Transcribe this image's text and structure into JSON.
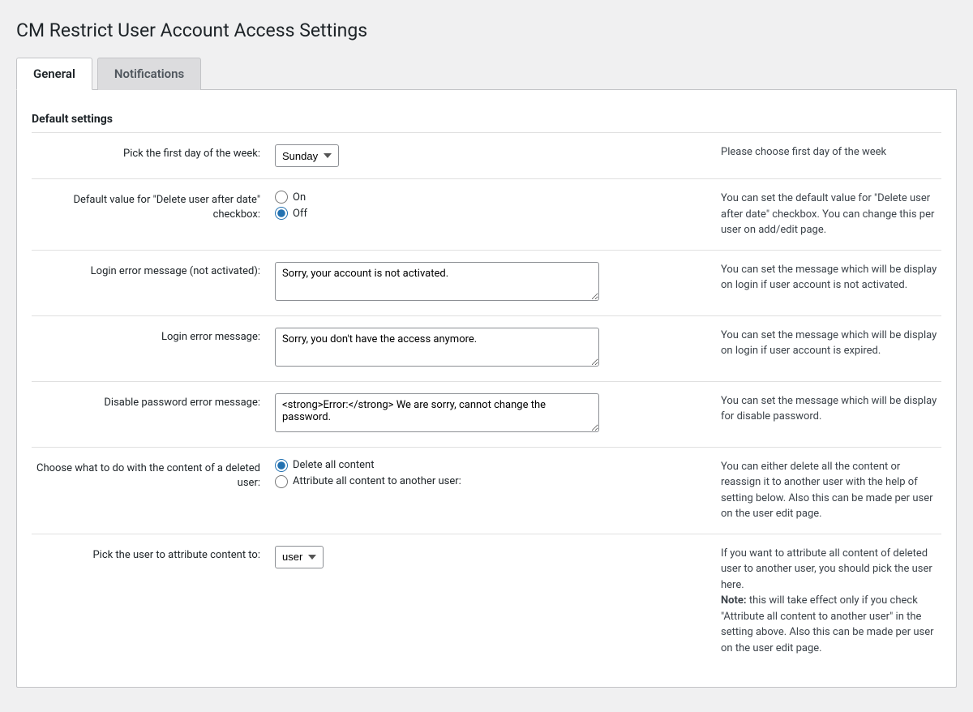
{
  "page_title": "CM Restrict User Account Access Settings",
  "tabs": {
    "general": "General",
    "notifications": "Notifications"
  },
  "section": {
    "title": "Default settings"
  },
  "rows": {
    "first_day": {
      "label": "Pick the first day of the week:",
      "value": "Sunday",
      "help": "Please choose first day of the week"
    },
    "delete_default": {
      "label": "Default value for \"Delete user after date\" checkbox:",
      "opt_on": "On",
      "opt_off": "Off",
      "help": "You can set the default value for \"Delete user after date\" checkbox. You can change this per user on add/edit page."
    },
    "err_not_activated": {
      "label": "Login error message (not activated):",
      "value": "Sorry, your account is not activated.",
      "help": "You can set the message which will be display on login if user account is not activated."
    },
    "err_login": {
      "label": "Login error message:",
      "value": "Sorry, you don't have the access anymore.",
      "help": "You can set the message which will be display on login if user account is expired."
    },
    "err_password": {
      "label": "Disable password error message:",
      "value": "<strong>Error:</strong> We are sorry, cannot change the password.",
      "help": "You can set the message which will be display for disable password."
    },
    "deleted_content": {
      "label": "Choose what to do with the content of a deleted user:",
      "opt_delete": "Delete all content",
      "opt_attribute": "Attribute all content to another user:",
      "help": "You can either delete all the content or reassign it to another user with the help of setting below. Also this can be made per user on the user edit page."
    },
    "attribute_user": {
      "label": "Pick the user to attribute content to:",
      "value": "user",
      "help_pre": "If you want to attribute all content of deleted user to another user, you should pick the user here.",
      "help_note_label": "Note:",
      "help_note": " this will take effect only if you check \"Attribute all content to another user\" in the setting above. Also this can be made per user on the user edit page."
    }
  }
}
